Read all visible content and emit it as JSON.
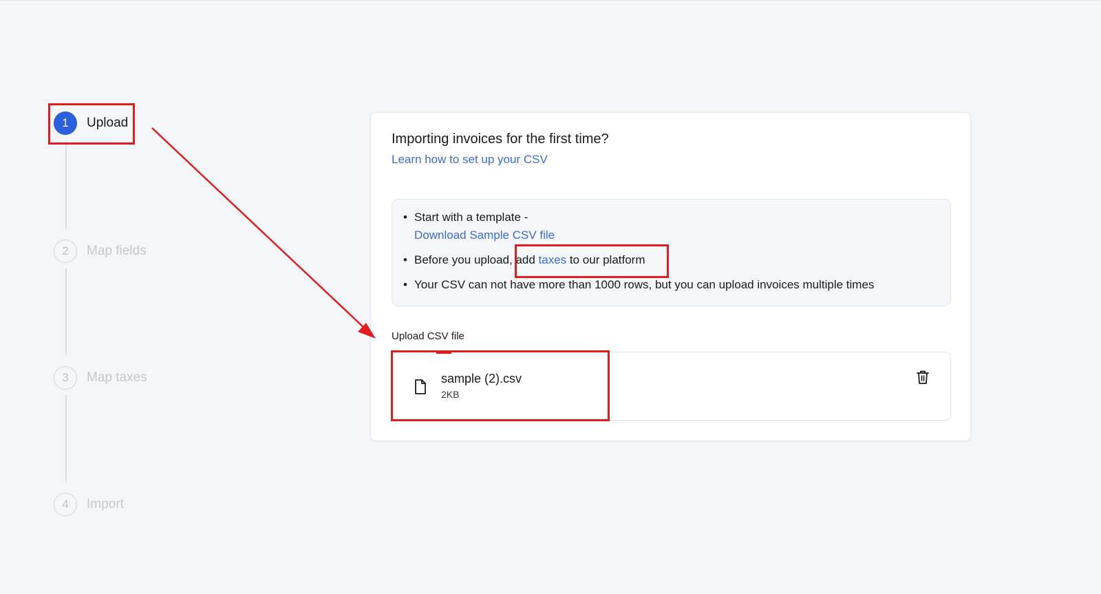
{
  "stepper": {
    "steps": [
      {
        "number": "1",
        "label": "Upload",
        "active": true
      },
      {
        "number": "2",
        "label": "Map fields",
        "active": false
      },
      {
        "number": "3",
        "label": "Map taxes",
        "active": false
      },
      {
        "number": "4",
        "label": "Import",
        "active": false
      }
    ]
  },
  "card": {
    "title": "Importing invoices for the first time?",
    "learn_link": "Learn how to set up your CSV",
    "info": {
      "item1_text": "Start with a template -",
      "item1_link": "Download Sample CSV file",
      "item2_prefix": "Before you upload,",
      "item2_add": " add ",
      "item2_link": "taxes",
      "item2_suffix": " to our platform",
      "item3_text": "Your CSV can not have more than 1000 rows, but you can upload invoices multiple times"
    },
    "upload_label": "Upload CSV file",
    "file": {
      "name": "sample (2).csv",
      "size": "2KB"
    }
  },
  "icons": {
    "file": "file-icon",
    "delete": "trash-icon"
  },
  "colors": {
    "accent": "#2b5fdc",
    "link": "#3b6bd9",
    "annotation": "#e01e1e"
  }
}
